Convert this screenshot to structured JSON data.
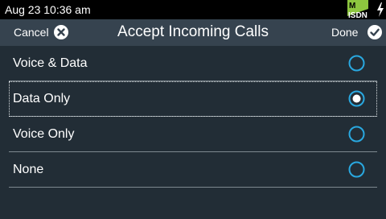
{
  "status_bar": {
    "datetime": "Aug 23 10:36 am",
    "network_mode_top": "M",
    "network_mode_bottom": "ISDN",
    "charge_icon": "lightning-bolt-icon"
  },
  "header": {
    "cancel_label": "Cancel",
    "cancel_icon": "close-circle-icon",
    "title": "Accept Incoming Calls",
    "done_label": "Done",
    "done_icon": "check-circle-icon"
  },
  "options": [
    {
      "label": "Voice & Data",
      "selected": false
    },
    {
      "label": "Data Only",
      "selected": true
    },
    {
      "label": "Voice Only",
      "selected": false
    },
    {
      "label": "None",
      "selected": false
    }
  ],
  "colors": {
    "background": "#222d36",
    "header": "#36434f",
    "accent": "#29a8e0",
    "network_green": "#8dc63f"
  }
}
